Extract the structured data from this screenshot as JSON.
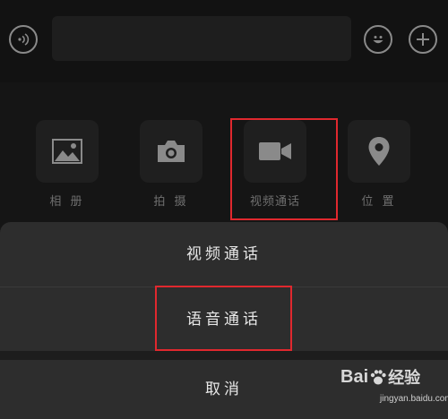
{
  "input_bar": {
    "voice_icon": "voice-wave-icon",
    "emoji_icon": "smiley-icon",
    "plus_icon": "plus-icon"
  },
  "tools": [
    {
      "label": "相 册",
      "icon": "image-icon"
    },
    {
      "label": "拍 摄",
      "icon": "camera-icon"
    },
    {
      "label": "视频通话",
      "icon": "video-camera-icon"
    },
    {
      "label": "位 置",
      "icon": "location-pin-icon"
    }
  ],
  "action_sheet": {
    "video_call": "视频通话",
    "voice_call": "语音通话",
    "cancel": "取消"
  },
  "watermark": {
    "brand_left": "Bai",
    "brand_right": "经验",
    "url": "jingyan.baidu.com"
  },
  "colors": {
    "highlight": "#e0282e",
    "sheet_bg": "#2d2d2d",
    "screen_bg": "#151515"
  }
}
